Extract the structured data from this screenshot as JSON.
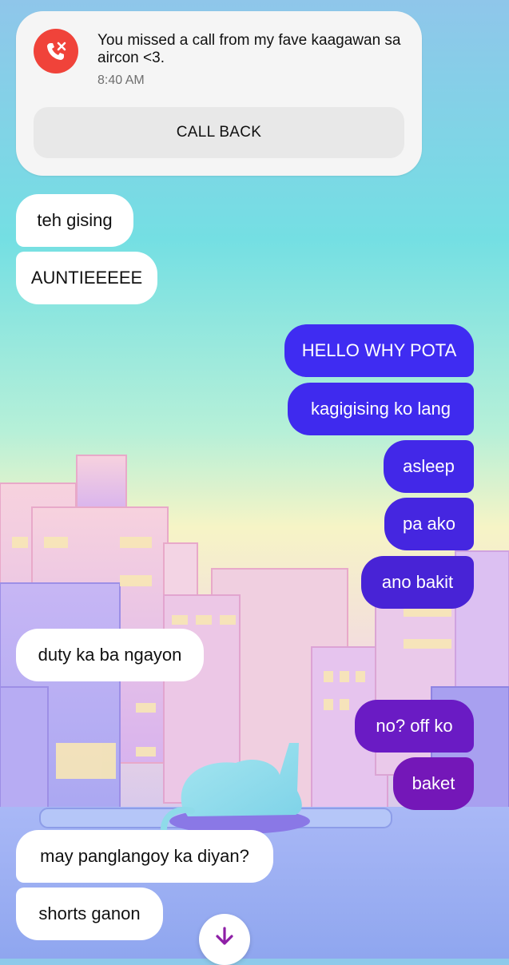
{
  "missed_call": {
    "message": "You missed a call from my fave kaagawan sa aircon <3.",
    "time": "8:40 AM",
    "action_label": "CALL BACK",
    "icon": "missed-call-icon",
    "icon_color": "#f0433a"
  },
  "messages": {
    "m1": {
      "sender": "them",
      "text": "teh gising"
    },
    "m2": {
      "sender": "them",
      "text": "AUNTIEEEEE"
    },
    "m3": {
      "sender": "me",
      "text": "HELLO WHY POTA"
    },
    "m4": {
      "sender": "me",
      "text": "kagigising ko lang"
    },
    "m5": {
      "sender": "me",
      "text": "asleep"
    },
    "m6": {
      "sender": "me",
      "text": "pa ako"
    },
    "m7": {
      "sender": "me",
      "text": "ano bakit"
    },
    "m8": {
      "sender": "them",
      "text": "duty ka ba ngayon"
    },
    "m9": {
      "sender": "me",
      "text": "no? off ko"
    },
    "m10": {
      "sender": "me",
      "text": "baket"
    },
    "m11": {
      "sender": "them",
      "text": "may panglangoy ka diyan?"
    },
    "m12": {
      "sender": "them",
      "text": "shorts ganon"
    }
  },
  "scroll_button": {
    "icon": "arrow-down-icon",
    "color": "#8e1fa6"
  },
  "colors": {
    "incoming_bubble": "#ffffff",
    "outgoing_gradient": [
      "#3f2df0",
      "#7a17b8"
    ]
  }
}
